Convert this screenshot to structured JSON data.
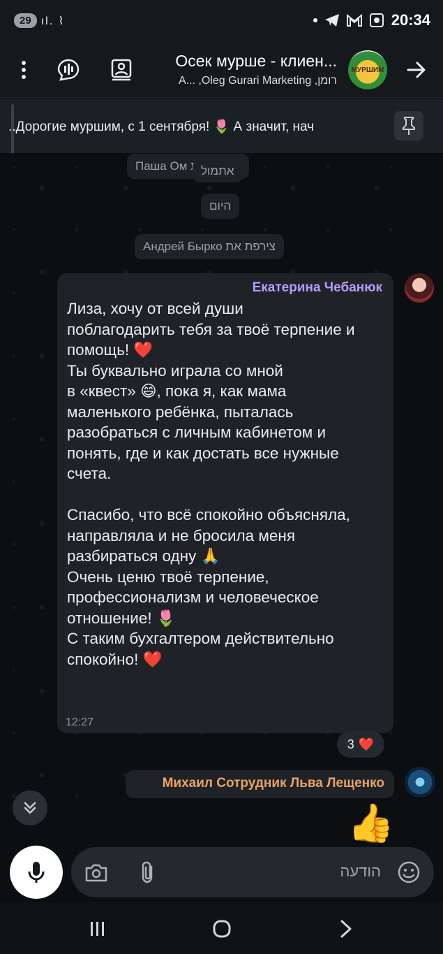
{
  "status_bar": {
    "battery_pill": "29",
    "signal_icons": "ıl. ⌇",
    "time": "20:34"
  },
  "header": {
    "title": "Осек мурше - клиен...",
    "subtitle": "A... ,Oleg Gurari Marketing ,רומן",
    "avatar_text": "МУРШИМ"
  },
  "pinned": {
    "text": "..Дорогие муршим, с 1 сентября! 🌷  А значит, нач"
  },
  "system_messages": {
    "joined_1": "Паша Ом צירפת את",
    "yesterday": "אתמול",
    "today": "היום",
    "joined_2": "Андрей Бырко צירפת את"
  },
  "message": {
    "sender": "Екатерина Чебанюк",
    "text": "Лиза, хочу от всей души\nпоблагодарить тебя за твоё терпение и\nпомощь! ❤️\nТы буквально играла со мной\nв «квест» 😄, пока я, как мама\nмаленького ребёнка, пыталась\nразобраться с личным кабинетом и\nпонять, где и как достать все нужные\nсчета.\n\nСпасибо, что всё спокойно объясняла,\nнаправляла и не бросила меня\nразбираться одну 🙏\nОчень ценю твоё терпение,\nпрофессионализм и человеческое\nотношение! 🌷\nС таким бухгалтером действительно\nспокойно! ❤️",
    "time": "12:27",
    "reaction_count": "3",
    "reaction_emoji": "❤️"
  },
  "message2": {
    "sender": "Михаил Сотрудник Льва Лещенко",
    "emoji": "👍"
  },
  "composer": {
    "placeholder": "הודעה"
  },
  "icons": {
    "menu": "more-vertical-icon",
    "voice_chat": "voice-chat-icon",
    "media": "media-icon",
    "back": "arrow-right-icon",
    "pin": "pin-icon",
    "scroll_down": "chevrons-down-icon",
    "mic": "mic-icon",
    "camera": "camera-icon",
    "attach": "paperclip-icon",
    "sticker": "sticker-icon"
  }
}
